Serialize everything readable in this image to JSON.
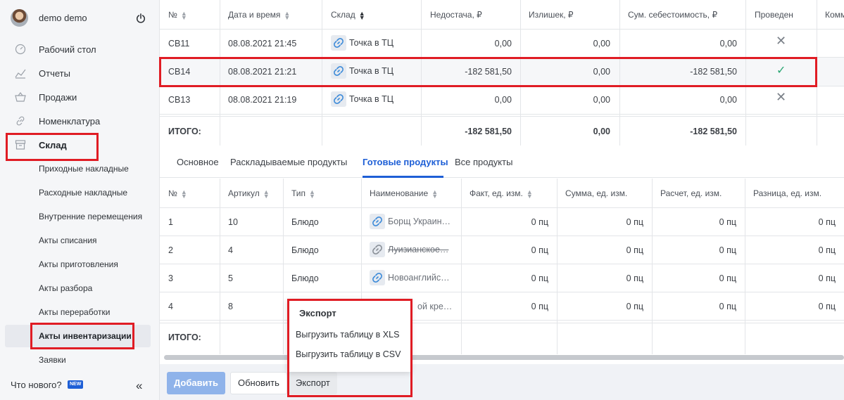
{
  "user": {
    "name": "demo demo"
  },
  "nav": [
    {
      "label": "Рабочий стол",
      "icon": "dashboard-icon"
    },
    {
      "label": "Отчеты",
      "icon": "chart-icon"
    },
    {
      "label": "Продажи",
      "icon": "basket-icon"
    },
    {
      "label": "Номенклатура",
      "icon": "link-icon"
    },
    {
      "label": "Склад",
      "icon": "archive-icon"
    }
  ],
  "sub_nav": [
    "Приходные накладные",
    "Расходные накладные",
    "Внутренние перемещения",
    "Акты списания",
    "Акты приготовления",
    "Акты разбора",
    "Акты переработки",
    "Акты инвентаризации",
    "Заявки"
  ],
  "sidebar_footer": {
    "whats_new": "Что нового?",
    "badge": "NEW",
    "collapse": "«"
  },
  "top_table": {
    "headers": [
      "№",
      "Дата и время",
      "Склад",
      "Недостача, ₽",
      "Излишек, ₽",
      "Сум. себестоимость, ₽",
      "Проведен",
      "Комм"
    ],
    "rows": [
      {
        "num": "СВ11",
        "date": "08.08.2021 21:45",
        "store": "Точка в ТЦ",
        "shortage": "0,00",
        "surplus": "0,00",
        "cost": "0,00",
        "posted": false
      },
      {
        "num": "СВ14",
        "date": "08.08.2021 21:21",
        "store": "Точка в ТЦ",
        "shortage": "-182 581,50",
        "surplus": "0,00",
        "cost": "-182 581,50",
        "posted": true
      },
      {
        "num": "СВ13",
        "date": "08.08.2021 21:19",
        "store": "Точка в ТЦ",
        "shortage": "0,00",
        "surplus": "0,00",
        "cost": "0,00",
        "posted": false
      }
    ],
    "total": {
      "label": "ИТОГО:",
      "shortage": "-182 581,50",
      "surplus": "0,00",
      "cost": "-182 581,50"
    }
  },
  "tabs": [
    "Основное",
    "Раскладываемые продукты",
    "Готовые продукты",
    "Все продукты"
  ],
  "active_tab": "Готовые продукты",
  "bottom_table": {
    "headers": [
      "№",
      "Артикул",
      "Тип",
      "Наименование",
      "Факт, ед. изм.",
      "Сумма, ед. изм.",
      "Расчет, ед. изм.",
      "Разница, ед. изм."
    ],
    "rows": [
      {
        "num": "1",
        "article": "10",
        "type": "Блюдо",
        "name": "Борщ Украин…",
        "fact": "0 пц",
        "sum": "0 пц",
        "calc": "0 пц",
        "diff": "0 пц"
      },
      {
        "num": "2",
        "article": "4",
        "type": "Блюдо",
        "name": "Луизианское…",
        "fact": "0 пц",
        "sum": "0 пц",
        "calc": "0 пц",
        "diff": "0 пц"
      },
      {
        "num": "3",
        "article": "5",
        "type": "Блюдо",
        "name": "Новоанглийс…",
        "fact": "0 пц",
        "sum": "0 пц",
        "calc": "0 пц",
        "diff": "0 пц"
      },
      {
        "num": "4",
        "article": "8",
        "type": "",
        "name": "ой кре…",
        "fact": "0 пц",
        "sum": "0 пц",
        "calc": "0 пц",
        "diff": "0 пц"
      }
    ],
    "total": {
      "label": "ИТОГО:"
    }
  },
  "buttons": {
    "add": "Добавить",
    "refresh": "Обновить",
    "export": "Экспорт"
  },
  "export_menu": {
    "title": "Экспорт",
    "items": [
      "Выгрузить таблицу в XLS",
      "Выгрузить таблицу в CSV"
    ]
  },
  "colors": {
    "accent": "#1e5fd6",
    "highlight": "#e01c24",
    "success": "#2aa673"
  }
}
